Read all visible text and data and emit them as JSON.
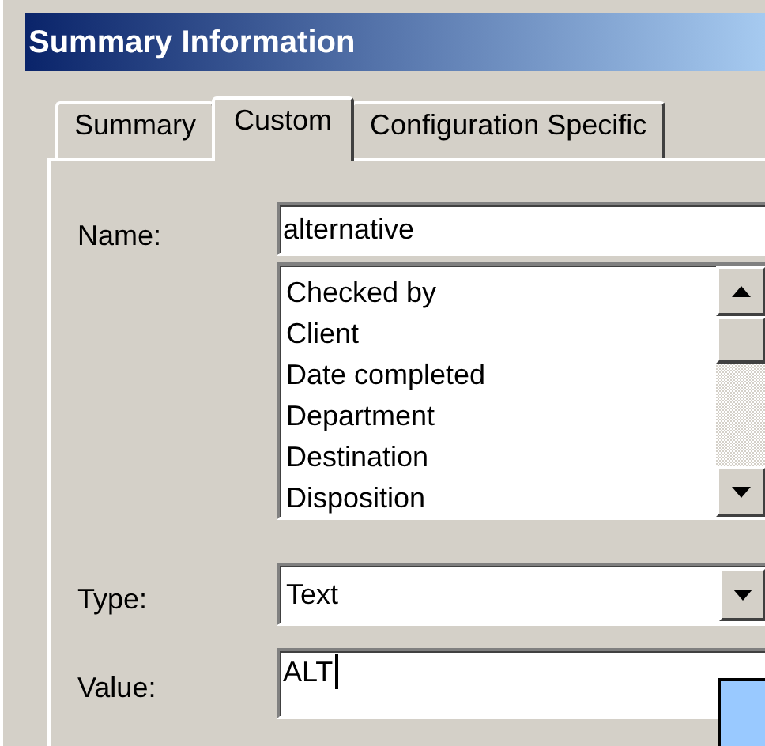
{
  "window": {
    "title": "Summary Information"
  },
  "tabs": [
    {
      "label": "Summary",
      "selected": false
    },
    {
      "label": "Custom",
      "selected": true
    },
    {
      "label": "Configuration Specific",
      "selected": false
    }
  ],
  "name": {
    "label": "Name:",
    "value": "alternative"
  },
  "property_list": {
    "items": [
      "Checked by",
      "Client",
      "Date completed",
      "Department",
      "Destination",
      "Disposition"
    ]
  },
  "type": {
    "label": "Type:",
    "value": "Text"
  },
  "value": {
    "label": "Value:",
    "value": "ALT"
  }
}
